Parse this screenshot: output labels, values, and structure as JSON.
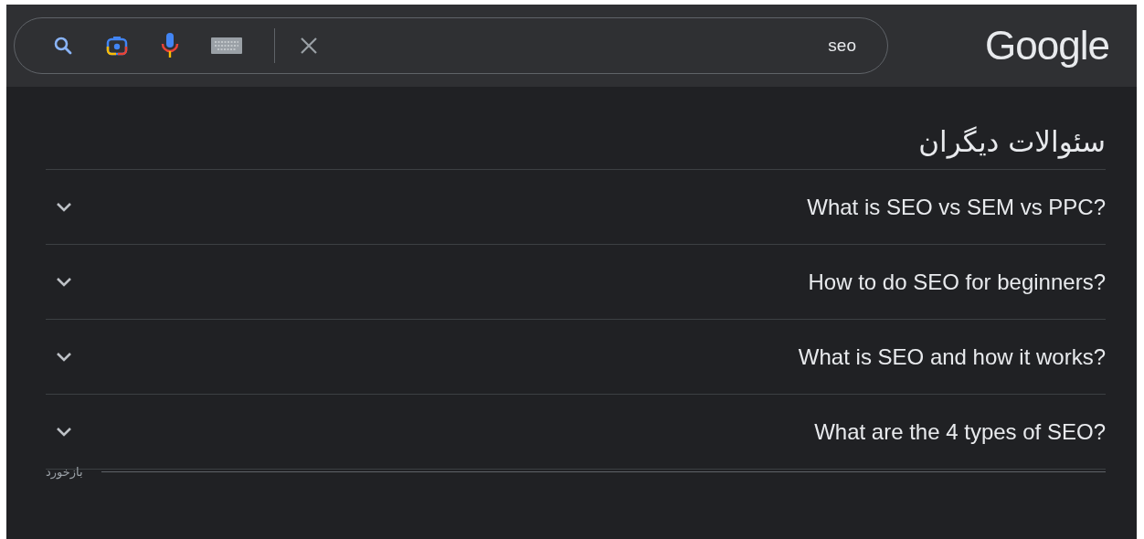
{
  "header": {
    "logo": "Google",
    "search": {
      "value": "seo"
    }
  },
  "people_also_ask": {
    "title": "سئوالات دیگران",
    "questions": [
      {
        "text": "What is SEO vs SEM vs PPC?",
        "expanded": false
      },
      {
        "text": "How to do SEO for beginners?",
        "expanded": false
      },
      {
        "text": "What is SEO and how it works?",
        "expanded": false
      },
      {
        "text": "What are the 4 types of SEO?",
        "expanded": false
      }
    ]
  },
  "feedback": "بازخورد"
}
